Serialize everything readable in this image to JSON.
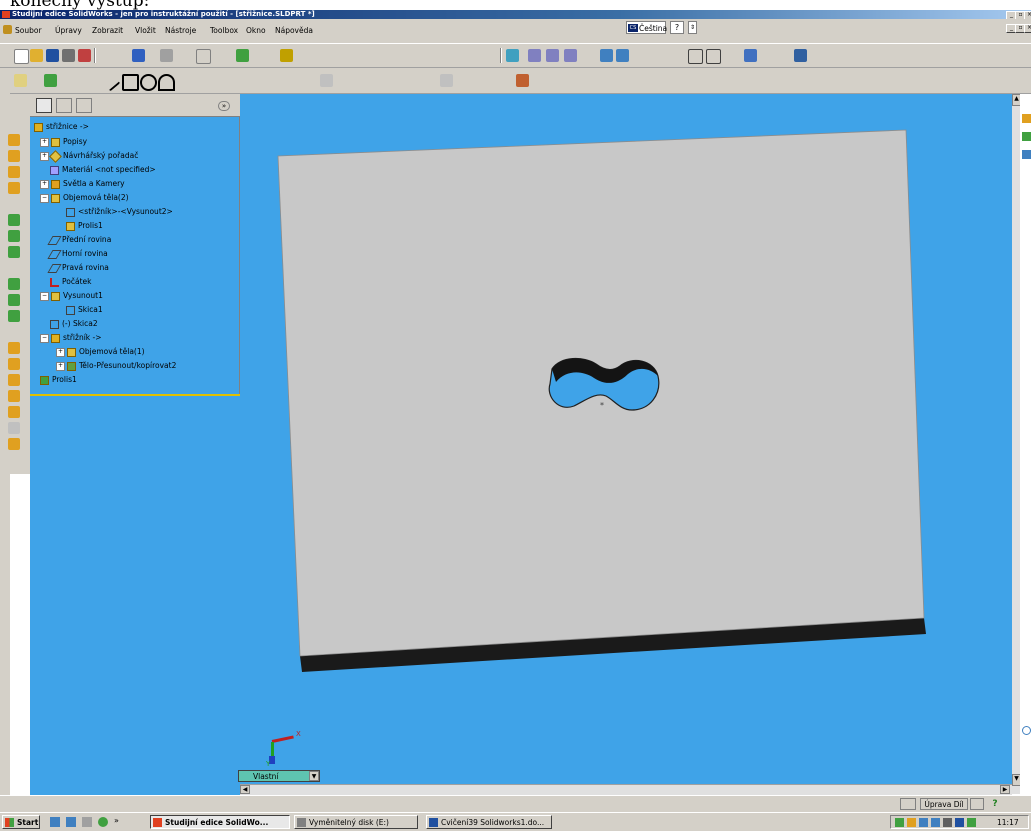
{
  "document_caption": "konečný výstup:",
  "window": {
    "title": "Studijní edice SolidWorks - jen pro instruktážní použití - [střižnice.SLDPRT *]"
  },
  "menu": {
    "items": [
      "Soubor",
      "Úpravy",
      "Zobrazit",
      "Vložit",
      "Nástroje",
      "Toolbox",
      "Okno",
      "Nápověda"
    ],
    "language": "Čeština",
    "help_icon": "help-icon"
  },
  "tree": {
    "items": [
      {
        "label": "střižnice ->",
        "icon": "part-icon",
        "expander": ""
      },
      {
        "label": "Popisy",
        "icon": "annotations-icon",
        "expander": "+"
      },
      {
        "label": "Návrhářský pořadač",
        "icon": "design-binder-icon",
        "expander": "+"
      },
      {
        "label": "Materiál <not specified>",
        "icon": "material-icon",
        "expander": ""
      },
      {
        "label": "Světla a Kamery",
        "icon": "lights-cameras-icon",
        "expander": "+"
      },
      {
        "label": "Objemová těla(2)",
        "icon": "solid-bodies-icon",
        "expander": "−"
      },
      {
        "label": "<střižník>-<Vysunout2>",
        "icon": "body-icon",
        "expander": ""
      },
      {
        "label": "Prolis1",
        "icon": "body-icon",
        "expander": ""
      },
      {
        "label": "Přední rovina",
        "icon": "plane-icon",
        "expander": ""
      },
      {
        "label": "Horní rovina",
        "icon": "plane-icon",
        "expander": ""
      },
      {
        "label": "Pravá rovina",
        "icon": "plane-icon",
        "expander": ""
      },
      {
        "label": "Počátek",
        "icon": "origin-icon",
        "expander": ""
      },
      {
        "label": "Vysunout1",
        "icon": "extrude-icon",
        "expander": "−"
      },
      {
        "label": "Skica1",
        "icon": "sketch-icon",
        "expander": ""
      },
      {
        "label": "(-) Skica2",
        "icon": "sketch-icon",
        "expander": ""
      },
      {
        "label": "střižník ->",
        "icon": "part-icon",
        "expander": "−"
      },
      {
        "label": "Objemová těla(1)",
        "icon": "solid-bodies-icon",
        "expander": "+"
      },
      {
        "label": "Tělo-Přesunout/kopírovat2",
        "icon": "move-copy-body-icon",
        "expander": "+"
      },
      {
        "label": "Prolis1",
        "icon": "cavity-icon",
        "expander": ""
      }
    ]
  },
  "view": {
    "orientation_label": "Vlastní",
    "triad_x": "X",
    "triad_y": "Y"
  },
  "status": {
    "mode": "Úprava Díl",
    "help": "?"
  },
  "taskbar": {
    "start": "Start",
    "tasks": [
      {
        "label": "Studijní edice SolidWo...",
        "active": true
      },
      {
        "label": "Vyměnitelný disk (E:)",
        "active": false
      },
      {
        "label": "Cvičení39 Solidworks1.do...",
        "active": false
      }
    ],
    "clock": "11:17"
  },
  "colors": {
    "viewport_bg": "#3fa3e8",
    "plate_top": "#c8c8c8",
    "plate_edge": "#1a1a1a",
    "title_bar": "#0a246a",
    "tree_bg": "#3fa3e8"
  }
}
